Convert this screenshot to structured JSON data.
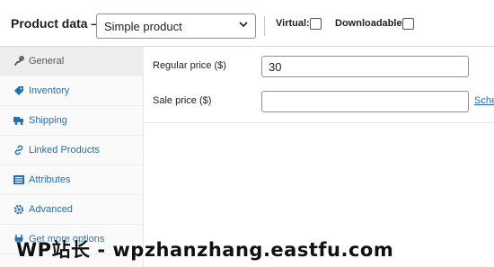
{
  "header": {
    "title": "Product data —",
    "product_type": "Simple product",
    "virtual_label": "Virtual:",
    "downloadable_label": "Downloadable:"
  },
  "sidebar": {
    "items": [
      {
        "label": "General",
        "icon": "wrench-icon",
        "active": true
      },
      {
        "label": "Inventory",
        "icon": "tag-icon"
      },
      {
        "label": "Shipping",
        "icon": "truck-icon"
      },
      {
        "label": "Linked Products",
        "icon": "link-icon"
      },
      {
        "label": "Attributes",
        "icon": "list-icon"
      },
      {
        "label": "Advanced",
        "icon": "gear-icon"
      },
      {
        "label": "Get more options",
        "icon": "plug-icon"
      }
    ]
  },
  "general": {
    "regular_price_label": "Regular price ($)",
    "regular_price_value": "30",
    "sale_price_label": "Sale price ($)",
    "sale_price_value": "",
    "schedule_link": "Sche"
  },
  "watermark": "WP站长 - wpzhanzhang.eastfu.com",
  "colors": {
    "link": "#2271b1",
    "active_tab_bg": "#eeeeee",
    "sidebar_bg": "#fafafa"
  }
}
